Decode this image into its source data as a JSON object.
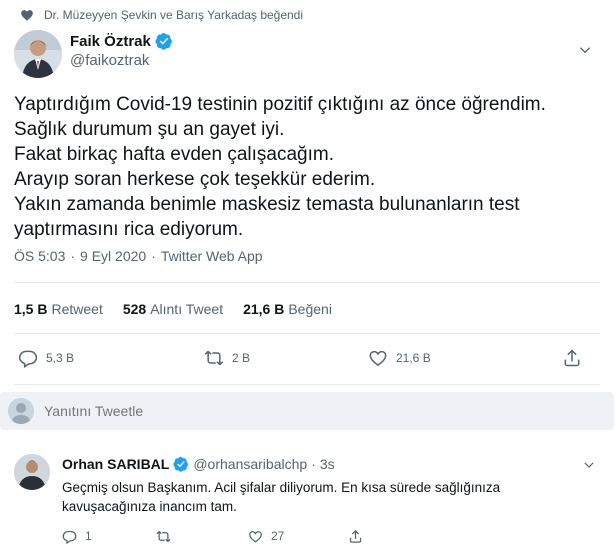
{
  "liked_by": {
    "text": "Dr. Müzeyyen Şevkin ve Barış Yarkadaş beğendi",
    "icon": "heart-icon"
  },
  "author": {
    "name": "Faik Öztrak",
    "handle": "@faikoztrak",
    "verified": true
  },
  "tweet": {
    "text": "Yaptırdığım Covid-19 testinin pozitif çıktığını az önce öğrendim.\nSağlık durumum şu an gayet iyi.\nFakat birkaç hafta evden çalışacağım.\nArayıp soran herkese çok teşekkür ederim.\nYakın zamanda benimle maskesiz temasta bulunanların test\nyaptırmasını rica ediyorum."
  },
  "meta": {
    "time": "ÖS 5:03",
    "date": "9 Eyl 2020",
    "source": "Twitter Web App",
    "sep": "·"
  },
  "stats": {
    "retweets": {
      "value": "1,5 B",
      "label": "Retweet"
    },
    "quotes": {
      "value": "528",
      "label": "Alıntı Tweet"
    },
    "likes": {
      "value": "21,6 B",
      "label": "Beğeni"
    }
  },
  "actions": {
    "reply_count": "5,3 B",
    "retweet_count": "2 B",
    "like_count": "21,6 B"
  },
  "reply_box": {
    "placeholder": "Yanıtını Tweetle"
  },
  "reply": {
    "name": "Orhan SARIBAL",
    "handle": "@orhansaribalchp",
    "dot": "·",
    "time": "3s",
    "text": "Geçmiş olsun Başkanım. Acil şifalar diliyorum. En kısa sürede sağlığınıza kavuşacağınıza inancım tam.",
    "reply_count": "1",
    "like_count": "27"
  },
  "colors": {
    "accent": "#1da1f2",
    "muted": "#536471",
    "text": "#0f1419",
    "divider": "#e6ecf0"
  }
}
